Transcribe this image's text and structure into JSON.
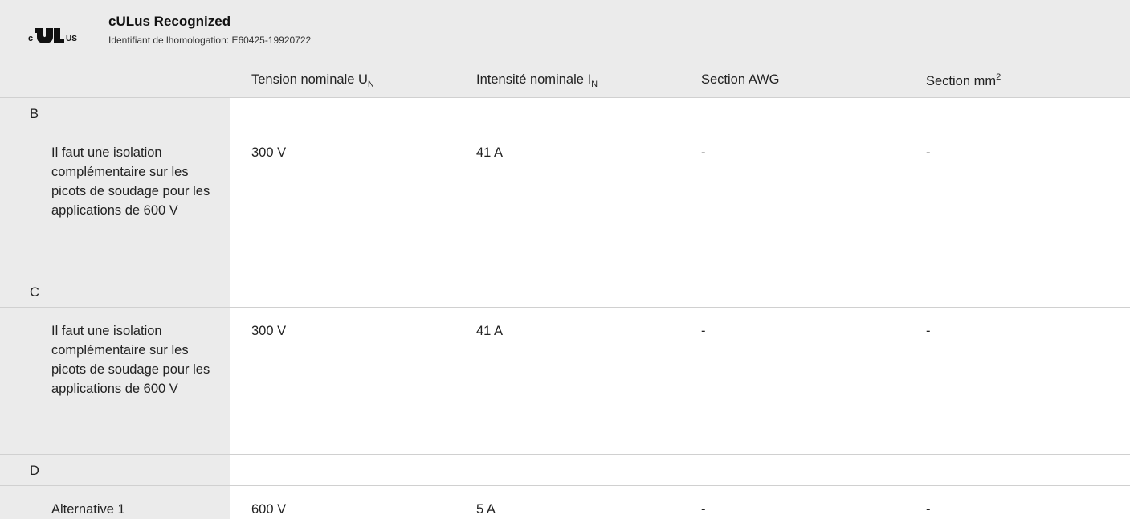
{
  "certificate": {
    "title": "cULus Recognized",
    "subtitle": "Identifiant de lhomologation: E60425-19920722"
  },
  "columns": {
    "voltage": {
      "label": "Tension nominale U",
      "sub": "N"
    },
    "current": {
      "label": "Intensité nominale I",
      "sub": "N"
    },
    "awg": {
      "label": "Section AWG"
    },
    "mm2": {
      "label": "Section mm",
      "sup": "2"
    }
  },
  "sections": [
    {
      "label": "B",
      "rows": [
        {
          "label": "Il faut une isolation complémentaire sur les picots de soudage pour les applications de 600 V",
          "voltage": "300 V",
          "current": "41 A",
          "awg": "-",
          "mm2": "-"
        }
      ]
    },
    {
      "label": "C",
      "rows": [
        {
          "label": "Il faut une isolation complémentaire sur les picots de soudage pour les applications de 600 V",
          "voltage": "300 V",
          "current": "41 A",
          "awg": "-",
          "mm2": "-"
        }
      ]
    },
    {
      "label": "D",
      "rows": [
        {
          "label": "Alternative 1",
          "voltage": "600 V",
          "current": "5 A",
          "awg": "-",
          "mm2": "-"
        }
      ]
    }
  ]
}
